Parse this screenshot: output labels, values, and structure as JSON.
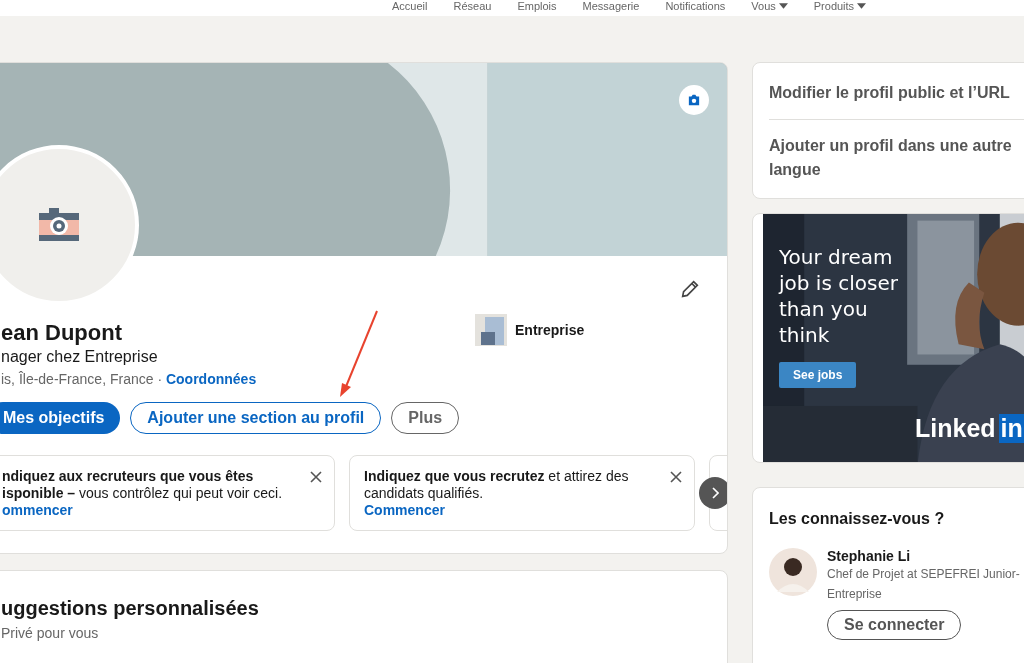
{
  "nav": {
    "items": [
      {
        "label": "Accueil",
        "caret": false
      },
      {
        "label": "Réseau",
        "caret": false
      },
      {
        "label": "Emplois",
        "caret": false
      },
      {
        "label": "Messagerie",
        "caret": false
      },
      {
        "label": "Notifications",
        "caret": false
      },
      {
        "label": "Vous",
        "caret": true
      },
      {
        "label": "Produits",
        "caret": true
      }
    ]
  },
  "profile": {
    "name": "ean Dupont",
    "headline": "nager chez Entreprise",
    "location": "is, Île-de-France, France · ",
    "contact_link": "Coordonnées",
    "company": "Entreprise",
    "actions": [
      {
        "label": "Mes objectifs",
        "kind": "primary"
      },
      {
        "label": "Ajouter une section au profil",
        "kind": "secondary"
      },
      {
        "label": "Plus",
        "kind": "neutral"
      }
    ],
    "suggestions": [
      {
        "text": "**ndiquez aux recruteurs que vous êtes isponible –** vous contrôlez qui peut voir ceci.",
        "link": "ommencer"
      },
      {
        "text": "**Indiquez que vous recrutez** et attirez des candidats qualifiés.",
        "link": "Commencer"
      }
    ]
  },
  "personal": {
    "title": "uggestions personnalisées",
    "subtitle": "Privé pour vous"
  },
  "sidebar": {
    "links": [
      "Modifier le profil public et l’URL",
      "Ajouter un profil dans une autre langue"
    ],
    "ad": {
      "headline": "Your dream job is closer than you think",
      "button": "See jobs",
      "brand": "Linked",
      "brand_box": "in"
    },
    "people": {
      "title": "Les connaissez-vous ?",
      "items": [
        {
          "name": "Stephanie Li",
          "subtitle": "Chef de Projet at SEPEFREI Junior-Entreprise",
          "action": "Se connecter"
        }
      ]
    }
  }
}
